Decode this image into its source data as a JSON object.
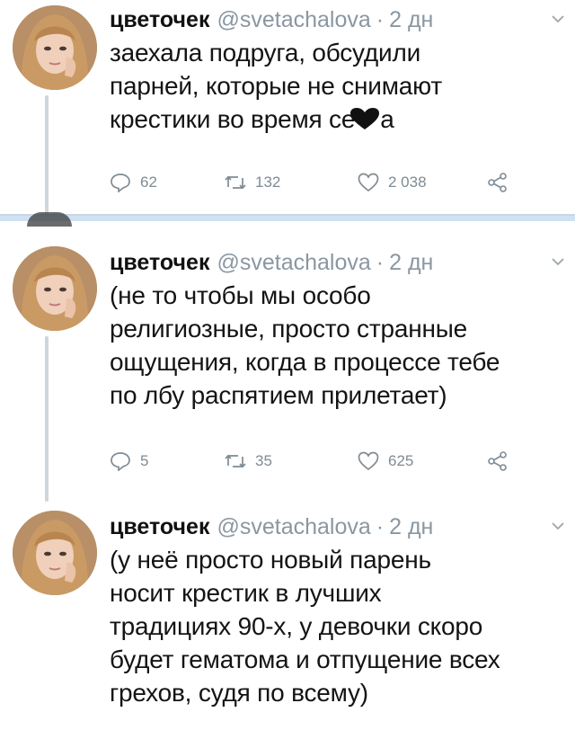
{
  "tweets": [
    {
      "name": "цветочек",
      "handle": "@svetachalova",
      "separator": "·",
      "time": "2 дн",
      "lines": [
        "заехала подруга, обсудили",
        "парней, которые не снимают",
        "крестики во время се",
        "а"
      ],
      "heart_icon": "black-heart-emoji",
      "replies": "62",
      "retweets": "132",
      "likes": "2 038"
    },
    {
      "name": "цветочек",
      "handle": "@svetachalova",
      "separator": "·",
      "time": "2 дн",
      "lines": [
        "(не то чтобы мы особо",
        "религиозные, просто странные",
        "ощущения, когда в процессе тебе",
        "по лбу распятием прилетает)"
      ],
      "replies": "5",
      "retweets": "35",
      "likes": "625"
    },
    {
      "name": "цветочек",
      "handle": "@svetachalova",
      "separator": "·",
      "time": "2 дн",
      "lines": [
        "(у неё просто новый парень",
        "носит крестик в лучших",
        "традициях 90-х, у девочки скоро",
        "будет гематома и отпущение всех",
        "грехов, судя по всему)"
      ]
    }
  ],
  "icons": {
    "reply": "reply-icon",
    "retweet": "retweet-icon",
    "like": "like-icon",
    "share": "share-icon",
    "caret": "chevron-down-icon"
  },
  "colors": {
    "text": "#141414",
    "muted": "#8a97a2",
    "divider": "#cfe2f3"
  }
}
